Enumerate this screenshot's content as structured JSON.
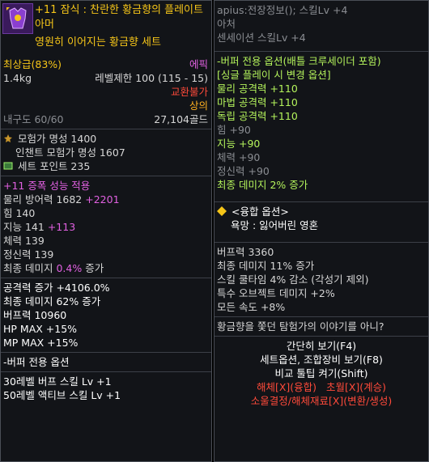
{
  "left": {
    "title": "+11 잠식 : 찬란한 황금향의 플레이트 아머",
    "set_name": "영원히 이어지는 황금향 세트",
    "grade": "최상급(83%)",
    "rarity": "에픽",
    "weight": "1.4kg",
    "level_limit": "레벨제한 100 (115 - 15)",
    "trade": "교환불가",
    "slot": "상의",
    "durability": "내구도 60/60",
    "price": "27,104골드",
    "adventurer_fame": "모험가 명성 1400",
    "enchant_fame": "인챈트 모험가 명성 1607",
    "set_point": "세트 포인트 235",
    "amp": "+11 증폭 성능 적용",
    "phys_def_label": "물리 방어력 1682",
    "phys_def_bonus": "+2201",
    "str": "힘 140",
    "int_label": "지능 141",
    "int_bonus": "+113",
    "vit": "체력 139",
    "spi": "정신력 139",
    "final_dmg_label": "최종 데미지",
    "final_dmg_value": "0.4%",
    "final_dmg_suffix": "증가",
    "atk_inc": "공격력 증가 +4106.0%",
    "final_dmg2": "최종 데미지 62% 증가",
    "buff_power": "버프력 10960",
    "hp_max": "HP MAX +15%",
    "mp_max": "MP MAX +15%",
    "buffer_opt": "-버퍼 전용 옵션",
    "buff_skill": "30레벨 버프 스킬 Lv +1",
    "active_skill": "50레벨 액티브 스킬 Lv +1"
  },
  "right": {
    "skill_info": "apius:전장정보(); 스킬Lv +4",
    "class": "아처",
    "sentinel": "센세이션 스킬Lv +4",
    "opt_title": "-버퍼 전용 옵션(배틀 크루세이더 포함)",
    "opt_change": "[싱글 플레이 시 변경 옵션]",
    "phys_atk": "물리 공격력 +110",
    "mag_atk": "마법 공격력 +110",
    "ind_atk": "독립 공격력 +110",
    "str": "힘 +90",
    "int": "지능 +90",
    "vit": "체력 +90",
    "spi": "정신력 +90",
    "final_dmg": "최종 데미지 2% 증가",
    "fusion_title": "<융합 옵션>",
    "fusion_name": "욕망 : 잃어버린 영혼",
    "buff_power": "버프력 3360",
    "final_dmg2": "최종 데미지 11% 증가",
    "cooldown": "스킬 쿨타임 4% 감소 (각성기 제외)",
    "object_dmg": "특수 오브젝트 데미지 +2%",
    "all_speed": "모든 속도 +8%",
    "lore": "황금향을 쫓던 탐험가의 이야기를 아니?",
    "simple_view": "간단히 보기(F4)",
    "set_view": "세트옵션, 조합장비 보기(F8)",
    "compare": "비교 툴팁 켜기(Shift)",
    "release_label": "해체[X](융합)",
    "transcend_label": "초월[X](계승)",
    "disassemble": "소울결정/해체재료[X](변환/생성)"
  },
  "colors": {
    "gold": "#f5c518",
    "green": "#b3f25b",
    "purple": "#e060e0",
    "red": "#ff4a3a",
    "background": "#121418"
  },
  "icons": [
    "armor-icon",
    "medal-icon",
    "set-icon",
    "fusion-diamond-icon"
  ]
}
